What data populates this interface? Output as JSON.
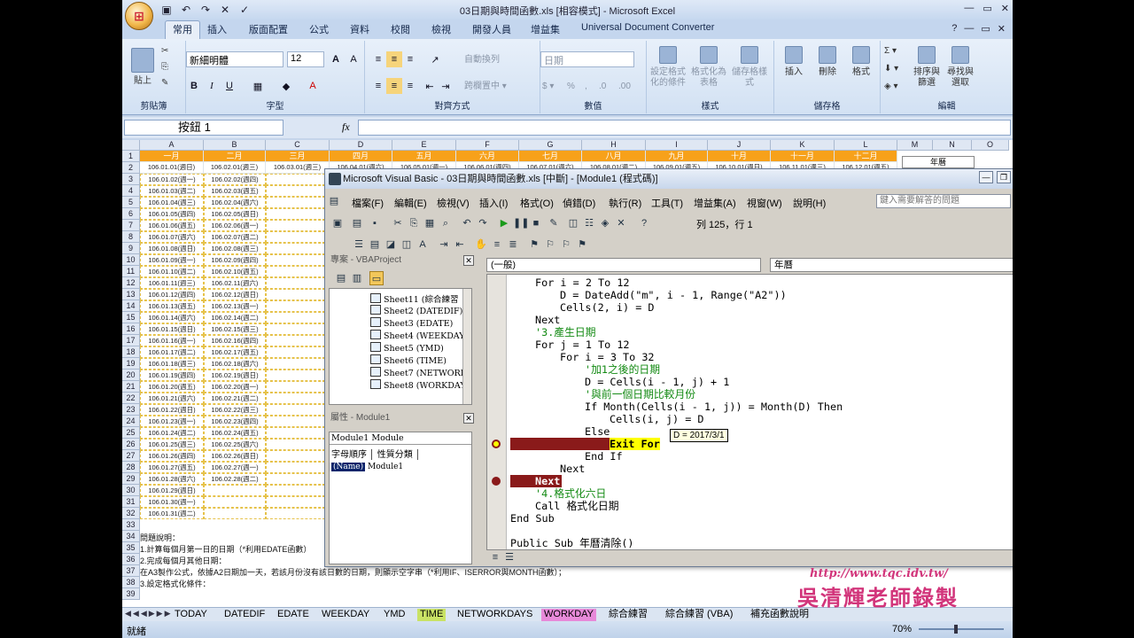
{
  "excel": {
    "title": "03日期與時間函數.xls [相容模式] - Microsoft Excel",
    "office_button_glyph": "⊞",
    "tabs": [
      "常用",
      "插入",
      "版面配置",
      "公式",
      "資料",
      "校閱",
      "檢視",
      "開發人員",
      "增益集",
      "Universal Document Converter"
    ],
    "ribbon": {
      "paste": "貼上",
      "clipboard": "剪貼簿",
      "font_name": "新細明體",
      "font_size": "12",
      "font_group": "字型",
      "align_group": "對齊方式",
      "wrap": "自動換列",
      "merge": "跨欄置中 ▾",
      "number_format": "日期",
      "number_group": "數值",
      "cond_format": "設定格式化的條件",
      "format_table": "格式化為表格",
      "cell_style": "儲存格樣式",
      "styles_group": "樣式",
      "insert": "插入",
      "delete": "刪除",
      "format": "格式",
      "cells_group": "儲存格",
      "sort_filter": "排序與篩選",
      "find_select": "尋找與選取",
      "edit_group": "編輯"
    },
    "name_box": "按鈕 1",
    "fx": "fx",
    "columns": [
      "A",
      "B",
      "C",
      "D",
      "E",
      "F",
      "G",
      "H",
      "I",
      "J",
      "K",
      "L",
      "M",
      "N",
      "O"
    ],
    "months": [
      "一月",
      "二月",
      "三月",
      "四月",
      "五月",
      "六月",
      "七月",
      "八月",
      "九月",
      "十月",
      "十一月",
      "十二月"
    ],
    "row2": [
      "106.01.01(週日)",
      "106.02.01(週三)",
      "106.03.01(週三)",
      "106.04.01(週六)",
      "106.05.01(週一)",
      "106.06.01(週四)",
      "106.07.01(週六)",
      "106.08.01(週二)",
      "106.09.01(週五)",
      "106.10.01(週日)",
      "106.11.01(週三)",
      "106.12.01(週五)"
    ],
    "year_label": "年曆",
    "colA": [
      "106.01.02(週一)",
      "106.01.03(週二)",
      "106.01.04(週三)",
      "106.01.05(週四)",
      "106.01.06(週五)",
      "106.01.07(週六)",
      "106.01.08(週日)",
      "106.01.09(週一)",
      "106.01.10(週二)",
      "106.01.11(週三)",
      "106.01.12(週四)",
      "106.01.13(週五)",
      "106.01.14(週六)",
      "106.01.15(週日)",
      "106.01.16(週一)",
      "106.01.17(週二)",
      "106.01.18(週三)",
      "106.01.19(週四)",
      "106.01.20(週五)",
      "106.01.21(週六)",
      "106.01.22(週日)",
      "106.01.23(週一)",
      "106.01.24(週二)",
      "106.01.25(週三)",
      "106.01.26(週四)",
      "106.01.27(週五)",
      "106.01.28(週六)",
      "106.01.29(週日)",
      "106.01.30(週一)",
      "106.01.31(週二)"
    ],
    "colB": [
      "106.02.02(週四)",
      "106.02.03(週五)",
      "106.02.04(週六)",
      "106.02.05(週日)",
      "106.02.06(週一)",
      "106.02.07(週二)",
      "106.02.08(週三)",
      "106.02.09(週四)",
      "106.02.10(週五)",
      "106.02.11(週六)",
      "106.02.12(週日)",
      "106.02.13(週一)",
      "106.02.14(週二)",
      "106.02.15(週三)",
      "106.02.16(週四)",
      "106.02.17(週五)",
      "106.02.18(週六)",
      "106.02.19(週日)",
      "106.02.20(週一)",
      "106.02.21(週二)",
      "106.02.22(週三)",
      "106.02.23(週四)",
      "106.02.24(週五)",
      "106.02.25(週六)",
      "106.02.26(週日)",
      "106.02.27(週一)",
      "106.02.28(週二)",
      "",
      "",
      ""
    ],
    "notes": [
      "問題說明：",
      "1.計算每個月第一日的日期（*利用EDATE函數）",
      "2.完成每個月其他日期：",
      "在A3製作公式，依據A2日期加一天，若該月份沒有該日數的日期，則顯示空字串（*利用IF、ISERROR與MONTH函數）；",
      "3.設定格式化條件："
    ],
    "sheet_tabs": [
      "TODAY",
      "DATEDIF",
      "EDATE",
      "WEEKDAY",
      "YMD",
      "TIME",
      "NETWORKDAYS",
      "WORKDAY",
      "綜合練習",
      "綜合練習 (VBA)",
      "補充函數說明"
    ],
    "status": "就緒",
    "zoom": "70%"
  },
  "vbe": {
    "title": "Microsoft Visual Basic - 03日期與時間函數.xls [中斷] - [Module1 (程式碼)]",
    "menu": [
      "檔案(F)",
      "編輯(E)",
      "檢視(V)",
      "插入(I)",
      "格式(O)",
      "偵錯(D)",
      "執行(R)",
      "工具(T)",
      "增益集(A)",
      "視窗(W)",
      "說明(H)"
    ],
    "help_placeholder": "鍵入需要解答的問題",
    "position": "列 125，行 1",
    "project_title": "專案 - VBAProject",
    "tree": [
      "Sheet11 (綜合練習",
      "Sheet2 (DATEDIF)",
      "Sheet3 (EDATE)",
      "Sheet4 (WEEKDAY",
      "Sheet5 (YMD)",
      "Sheet6 (TIME)",
      "Sheet7 (NETWORK",
      "Sheet8 (WORKDAY"
    ],
    "props_title": "屬性 - Module1",
    "props_object": "Module1 Module",
    "props_tabs": "字母順序 │ 性質分類 │",
    "props_name_key": "(Name)",
    "props_name_val": "Module1",
    "object_combo": "(一般)",
    "proc_combo": "年曆",
    "code": [
      {
        "t": "For i = 2 To 12",
        "indent": 1,
        "type": "kw"
      },
      {
        "t": "D = DateAdd(\"m\", i - 1, Range(\"A2\"))",
        "indent": 2,
        "type": "kw"
      },
      {
        "t": "Cells(2, i) = D",
        "indent": 2,
        "type": "kw"
      },
      {
        "t": "Next",
        "indent": 1,
        "type": "kw"
      },
      {
        "t": "'3.產生日期",
        "indent": 1,
        "type": "cm"
      },
      {
        "t": "For j = 1 To 12",
        "indent": 1,
        "type": "kw"
      },
      {
        "t": "For i = 3 To 32",
        "indent": 2,
        "type": "kw"
      },
      {
        "t": "'加1之後的日期",
        "indent": 3,
        "type": "cm"
      },
      {
        "t": "D = Cells(i - 1, j) + 1",
        "indent": 3,
        "type": "kw"
      },
      {
        "t": "'與前一個日期比較月份",
        "indent": 3,
        "type": "cm"
      },
      {
        "t": "If Month(Cells(i - 1, j)) = Month(D) Then",
        "indent": 3,
        "type": "kw"
      },
      {
        "t": "Cells(i, j) = D",
        "indent": 4,
        "type": "kw"
      },
      {
        "t": "Else",
        "indent": 3,
        "type": "kw"
      },
      {
        "t": "Exit For",
        "indent": 4,
        "type": "exec"
      },
      {
        "t": "End If",
        "indent": 3,
        "type": "kw"
      },
      {
        "t": "Next",
        "indent": 2,
        "type": "kw"
      },
      {
        "t": "Next",
        "indent": 1,
        "type": "bp"
      },
      {
        "t": "'4.格式化六日",
        "indent": 1,
        "type": "cm"
      },
      {
        "t": "Call 格式化日期",
        "indent": 1,
        "type": "kw"
      },
      {
        "t": "End Sub",
        "indent": 0,
        "type": "kw"
      },
      {
        "t": "",
        "indent": 0,
        "type": "kw"
      },
      {
        "t": "Public Sub 年曆清除()",
        "indent": 0,
        "type": "kw"
      }
    ],
    "tooltip": "D = 2017/3/1"
  },
  "watermark": {
    "url": "http://www.tqc.idv.tw/",
    "name": "吳清輝老師錄製"
  }
}
